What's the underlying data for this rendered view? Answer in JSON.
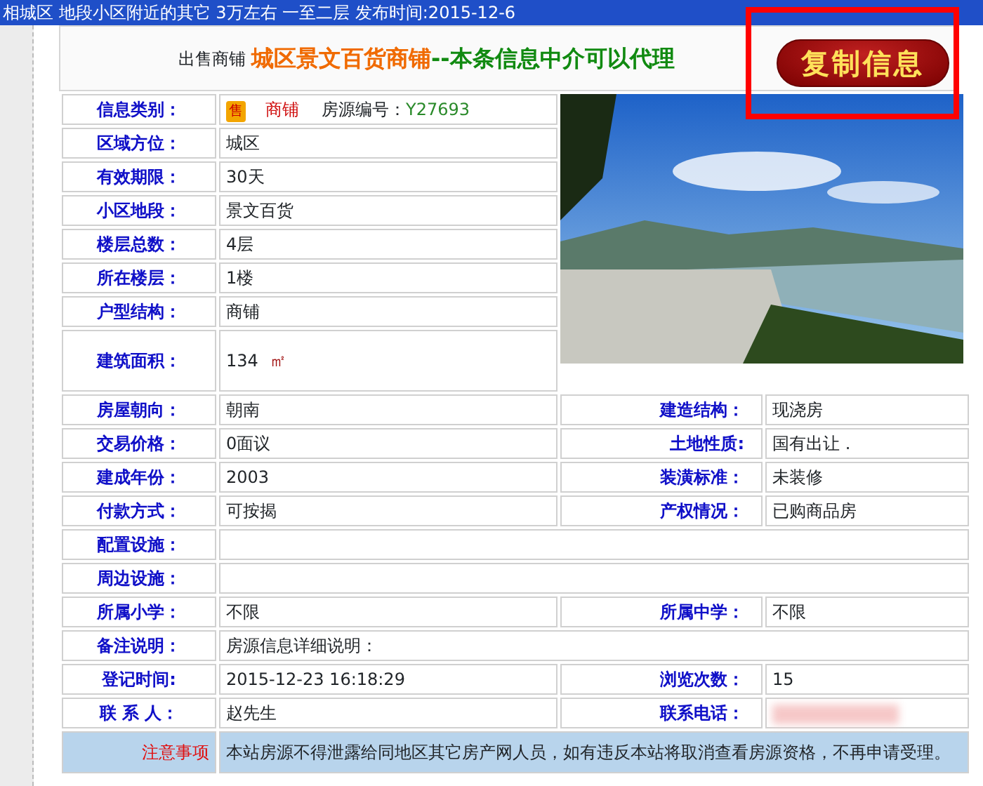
{
  "banner": {
    "text": "相城区 地段小区附近的其它 3万左右 一至二层 发布时间:2015-12-6"
  },
  "header": {
    "prefix": "出售商铺",
    "title": "城区景文百货商铺",
    "suffix": "--本条信息中介可以代理"
  },
  "copy_button": {
    "label": "复制信息",
    "highlighted": true
  },
  "category_row": {
    "label": "信息类别：",
    "badge": "售",
    "type": "商铺",
    "id_label": "房源编号：",
    "id": "Y27693"
  },
  "side_rows": [
    {
      "label": "区域方位：",
      "value": "城区"
    },
    {
      "label": "有效期限：",
      "value": "30天"
    },
    {
      "label": "小区地段：",
      "value": "景文百货"
    },
    {
      "label": "楼层总数：",
      "value": "4层"
    },
    {
      "label": "所在楼层：",
      "value": "1楼"
    },
    {
      "label": "户型结构：",
      "value": "商铺"
    },
    {
      "label": "建筑面积：",
      "value": "134",
      "unit": "㎡"
    }
  ],
  "rows": [
    {
      "kind": "pair",
      "label": "房屋朝向：",
      "value": "朝南",
      "label2": "建造结构：",
      "value2": "现浇房"
    },
    {
      "kind": "pair",
      "label": "交易价格：",
      "value": "0面议",
      "label2": "土地性质:",
      "value2": "国有出让 ."
    },
    {
      "kind": "pair",
      "label": "建成年份：",
      "value": "2003",
      "label2": "装潢标准：",
      "value2": "未装修"
    },
    {
      "kind": "pair",
      "label": "付款方式：",
      "value": "可按揭",
      "label2": "产权情况：",
      "value2": "已购商品房"
    },
    {
      "kind": "full",
      "label": "配置设施："
    },
    {
      "kind": "full",
      "label": "周边设施："
    },
    {
      "kind": "pair",
      "label": "所属小学：",
      "value": "不限",
      "label2": "所属中学：",
      "value2": "不限"
    },
    {
      "kind": "full",
      "label": "备注说明：",
      "value": "房源信息详细说明："
    },
    {
      "kind": "pair",
      "label": "登记时间:",
      "value": "2015-12-23 16:18:29",
      "label2": "浏览次数：",
      "value2": "15"
    },
    {
      "kind": "redacted",
      "label": "联 系 人：",
      "value": "赵先生",
      "label2": "联系电话："
    }
  ],
  "notice": {
    "label": "注意事项",
    "text": "本站房源不得泄露给同地区其它房产网人员，如有违反本站将取消查看房源资格，不再申请受理。"
  }
}
